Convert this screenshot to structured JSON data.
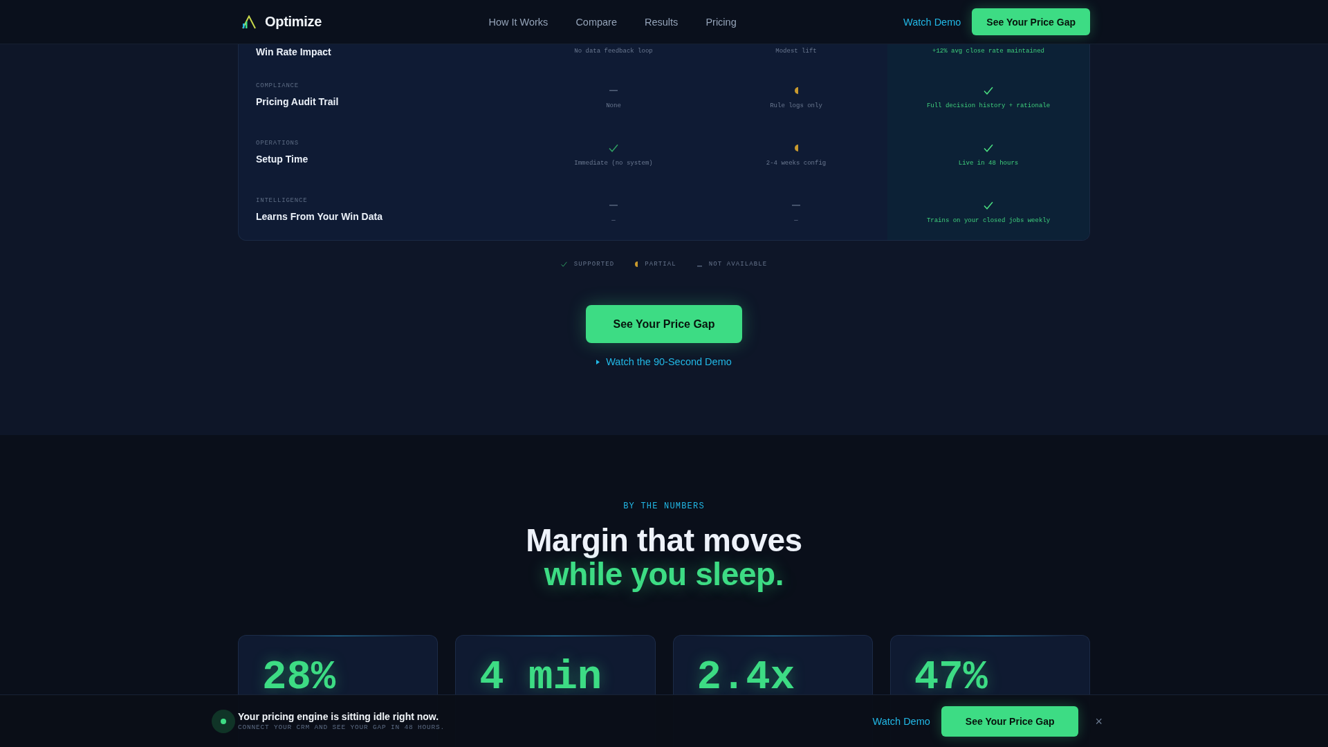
{
  "nav": {
    "brand": "Optimize",
    "links": [
      "How It Works",
      "Compare",
      "Results",
      "Pricing"
    ],
    "watch_demo": "Watch Demo",
    "cta": "See Your Price Gap"
  },
  "comparison": {
    "columns": [
      {
        "highlighted": false
      },
      {
        "highlighted": false
      },
      {
        "highlighted": true
      }
    ],
    "rows": [
      {
        "title": "Win Rate Impact",
        "cells": [
          {
            "note": "No data feedback loop"
          },
          {
            "note": "Modest lift"
          },
          {
            "note": "+12% avg close rate maintained"
          }
        ]
      },
      {
        "category": "COMPLIANCE",
        "title": "Pricing Audit Trail",
        "cells": [
          {
            "kind": "none",
            "note": "None"
          },
          {
            "kind": "partial",
            "note": "Rule logs only"
          },
          {
            "kind": "supported",
            "note": "Full decision history + rationale"
          }
        ]
      },
      {
        "category": "OPERATIONS",
        "title": "Setup Time",
        "cells": [
          {
            "kind": "supported",
            "note": "Immediate (no system)"
          },
          {
            "kind": "partial",
            "note": "2-4 weeks config"
          },
          {
            "kind": "supported",
            "note": "Live in 48 hours"
          }
        ]
      },
      {
        "category": "INTELLIGENCE",
        "title": "Learns From Your Win Data",
        "cells": [
          {
            "kind": "none",
            "note": "—"
          },
          {
            "kind": "none",
            "note": "—"
          },
          {
            "kind": "supported",
            "note": "Trains on your closed jobs weekly"
          }
        ]
      }
    ],
    "legend": [
      {
        "kind": "supported",
        "label": "SUPPORTED"
      },
      {
        "kind": "partial",
        "label": "PARTIAL"
      },
      {
        "kind": "none",
        "label": "NOT AVAILABLE"
      }
    ]
  },
  "cta": {
    "button": "See Your Price Gap",
    "demo_link": "Watch the 90-Second Demo"
  },
  "numbers": {
    "eyebrow": "BY THE NUMBERS",
    "heading": "Margin that moves",
    "heading_accent": "while you sleep.",
    "stats": [
      {
        "value": "28%"
      },
      {
        "value": "4 min"
      },
      {
        "value": "2.4x"
      },
      {
        "value": "47%"
      }
    ]
  },
  "sticky_bar": {
    "message": "Your pricing engine is sitting idle right now.",
    "subtext": "CONNECT YOUR CRM AND SEE YOUR GAP IN 48 HOURS.",
    "watch_demo": "Watch Demo",
    "cta": "See Your Price Gap",
    "close": "×"
  }
}
